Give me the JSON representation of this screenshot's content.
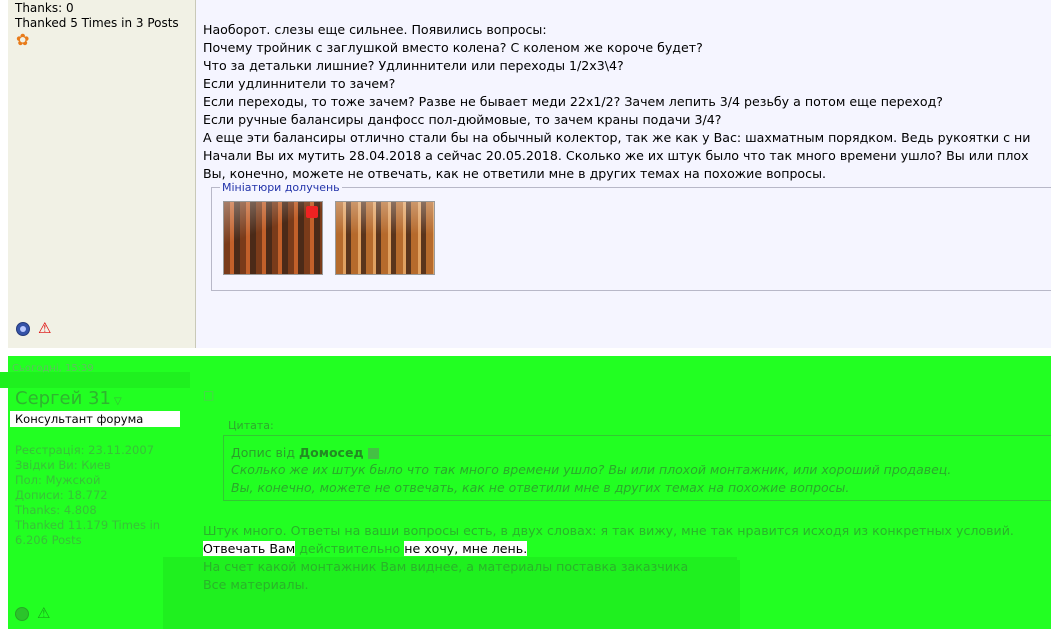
{
  "post1": {
    "user_stats": {
      "thanks": "Thanks: 0",
      "thanked": "Thanked 5 Times in 3 Posts"
    },
    "icons": {
      "aim": "aim-icon",
      "online": "online-status-icon",
      "report": "report-icon"
    },
    "lines": [
      "Наоборот. слезы еще сильнее. Появились вопросы:",
      "Почему тройник с заглушкой вместо колена? С коленом же короче будет?",
      "Что за детальки лишние? Удлиннители или переходы 1/2x3\\4?",
      "Если удлиннители то зачем?",
      "Если переходы, то тоже зачем? Разве не бывает меди 22x1/2? Зачем лепить 3/4 резьбу а потом еще переход?",
      "Если ручные балансиры данфосс пол-дюймовые, то зачем краны подачи 3/4?",
      "А еще эти балансиры отлично стали бы на обычный колектор, так же как у Вас: шахматным порядком. Ведь рукоятки с ни",
      "Начали Вы их мутить 28.04.2018 а сейчас 20.05.2018. Сколько же их штук было что так много времени ушло? Вы или плох",
      "Вы, конечно, можете не отвечать, как не ответили мне в других темах на похожие вопросы."
    ],
    "attachments_legend": "Мініатюри долучень"
  },
  "post2": {
    "date": "Сьогодні, 15:39",
    "username": "Сергей 31",
    "role": "Консультант форума",
    "stats": [
      "Реєстрація: 23.11.2007",
      "Звідки Ви: Киев",
      "Пол: Мужской",
      "Дописи: 18.772",
      "Thanks: 4.808",
      "Thanked 11.179 Times in",
      "6.206 Posts"
    ],
    "quote": {
      "label": "Цитата:",
      "prefix": "Допис від",
      "author": "Домосед",
      "lines": [
        "Сколько же их штук было что так много времени ушло? Вы или плохой монтажник, или хороший продавец.",
        "Вы, конечно, можете не отвечать, как не ответили мне в других темах на похожие вопросы."
      ]
    },
    "reply": {
      "line1": "Штук много. Ответы на ваши вопросы есть, в двух словах: я так вижу, мне так нравится исходя из конкретных условий.",
      "line2_a": "Отвечать Вам",
      "line2_b": " действительно ",
      "line2_c": "не хочу, мне лень.",
      "line3": "На счет какой монтажник Вам виднее, а материалы поставка заказчика",
      "line4": "Все материалы."
    }
  },
  "colors": {
    "overlay_green": "#22ff22",
    "post_bg": "#f5f5ff",
    "side_bg": "#f1f1e5"
  }
}
